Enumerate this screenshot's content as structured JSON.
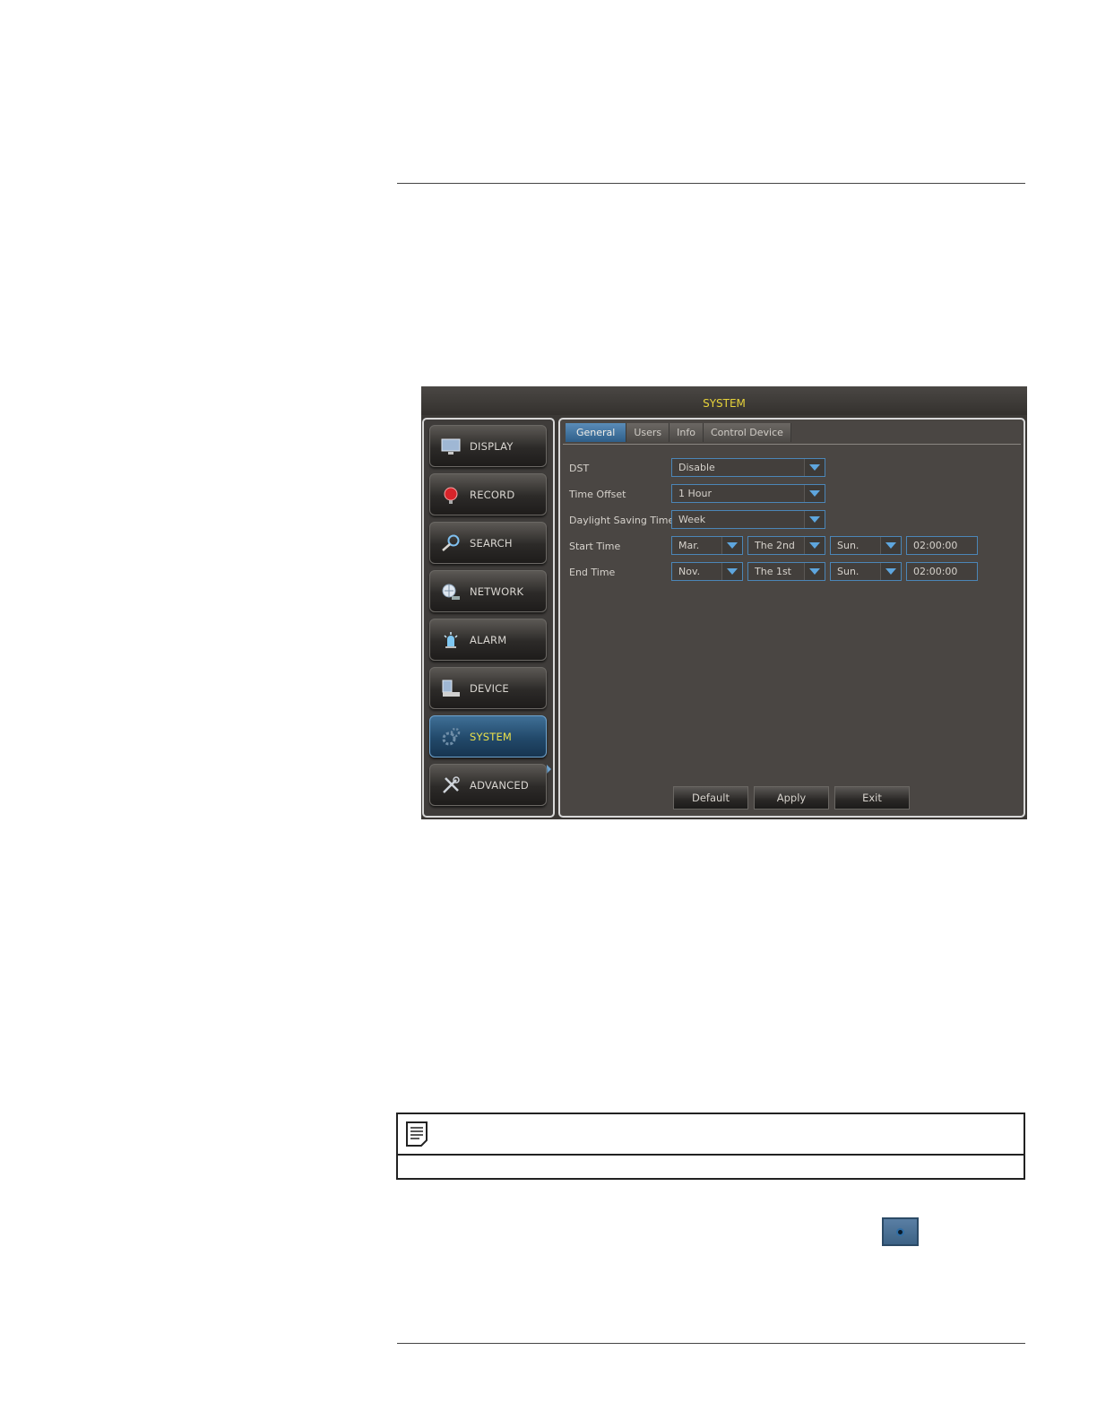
{
  "window": {
    "title": "SYSTEM"
  },
  "sidebar": {
    "items": [
      {
        "label": "DISPLAY",
        "icon": "monitor-icon"
      },
      {
        "label": "RECORD",
        "icon": "record-icon"
      },
      {
        "label": "SEARCH",
        "icon": "search-icon"
      },
      {
        "label": "NETWORK",
        "icon": "network-icon"
      },
      {
        "label": "ALARM",
        "icon": "alarm-icon"
      },
      {
        "label": "DEVICE",
        "icon": "device-icon"
      },
      {
        "label": "SYSTEM",
        "icon": "gear-icon",
        "active": true
      },
      {
        "label": "ADVANCED",
        "icon": "tools-icon"
      }
    ]
  },
  "tabs": [
    {
      "label": "General",
      "active": true
    },
    {
      "label": "Users"
    },
    {
      "label": "Info"
    },
    {
      "label": "Control Device"
    }
  ],
  "form": {
    "dst": {
      "label": "DST",
      "value": "Disable"
    },
    "time_offset": {
      "label": "Time Offset",
      "value": "1 Hour"
    },
    "dst_mode": {
      "label": "Daylight Saving Time",
      "value": "Week"
    },
    "start": {
      "label": "Start Time",
      "month": "Mar.",
      "week": "The 2nd",
      "day": "Sun.",
      "time": "02:00:00"
    },
    "end": {
      "label": "End Time",
      "month": "Nov.",
      "week": "The 1st",
      "day": "Sun.",
      "time": "02:00:00"
    }
  },
  "buttons": {
    "default": "Default",
    "apply": "Apply",
    "exit": "Exit"
  },
  "colors": {
    "title_text": "#e6d23a",
    "accent": "#4b86b7",
    "active_tab": "#3f75a3"
  }
}
